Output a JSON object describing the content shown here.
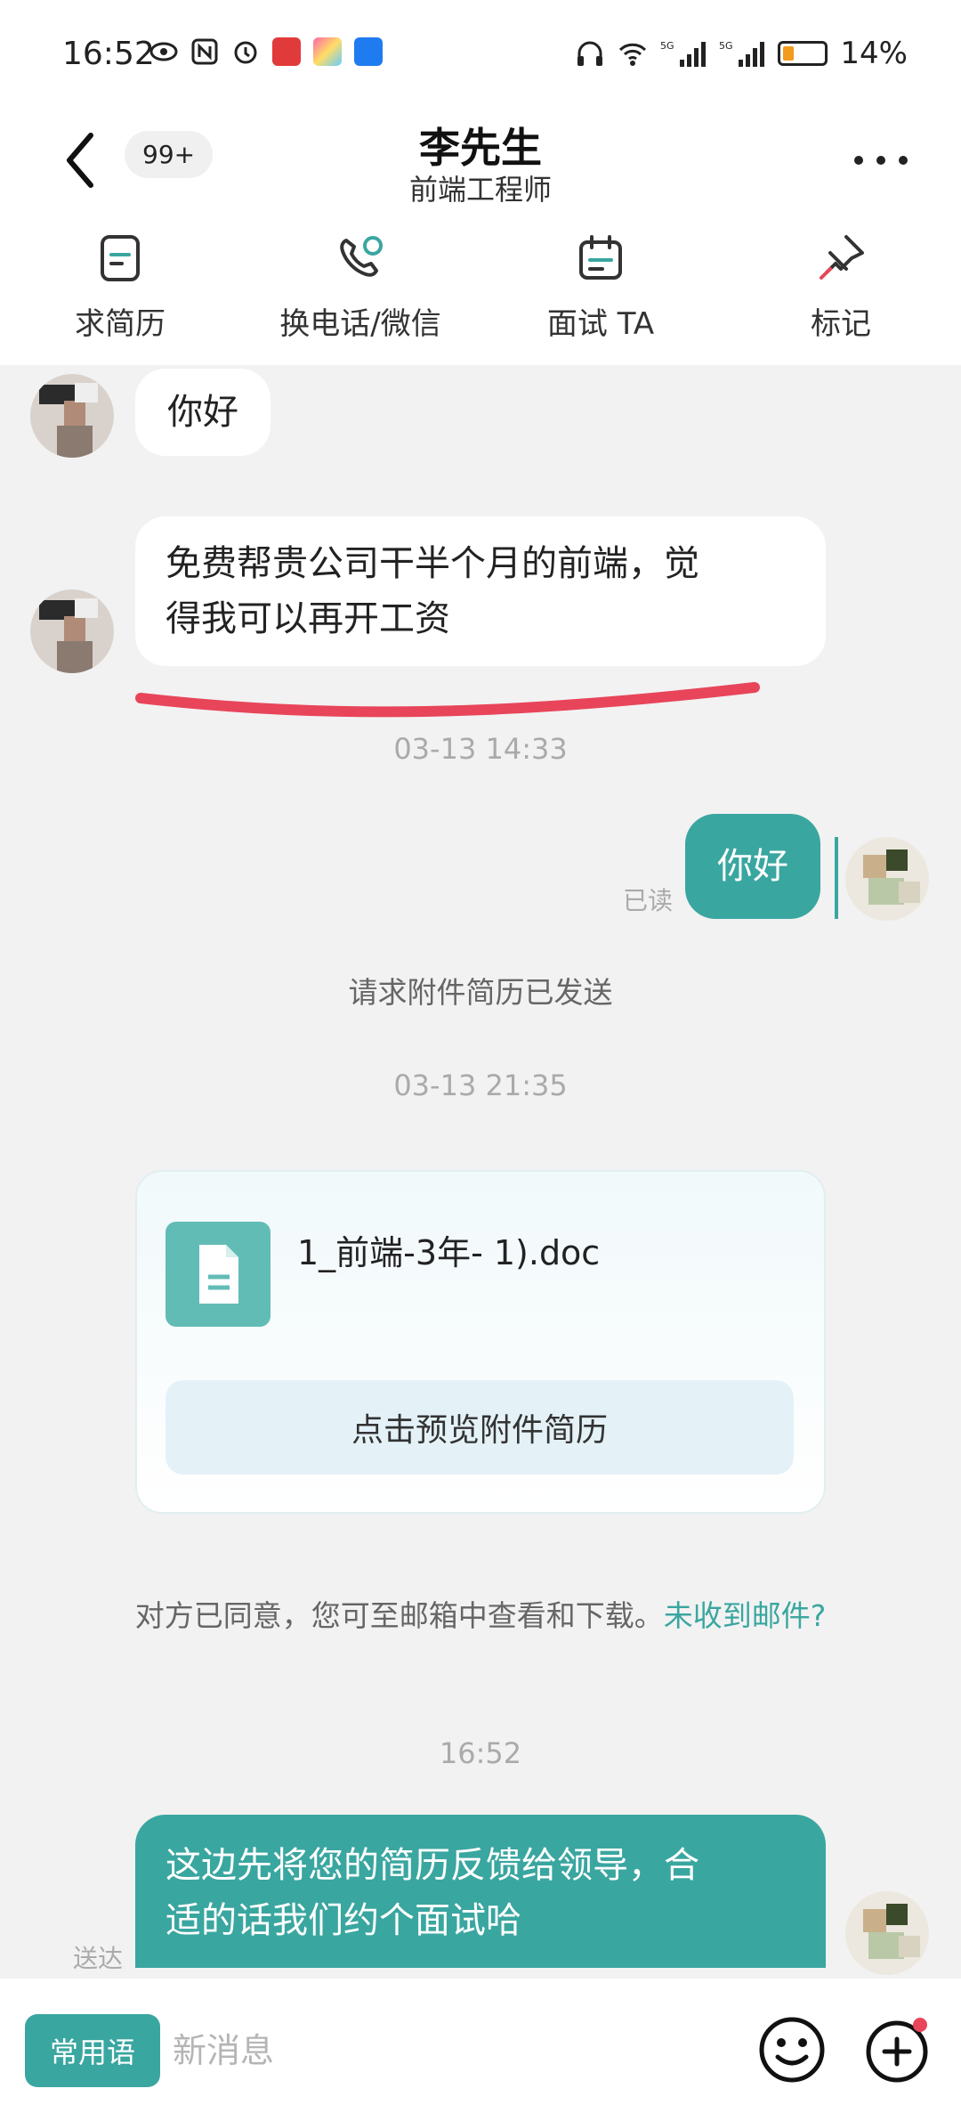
{
  "status_bar": {
    "time": "16:52",
    "battery_percent": "14%",
    "battery_level": 0.14,
    "network": "5G"
  },
  "header": {
    "badge": "99+",
    "name": "李先生",
    "position": "前端工程师"
  },
  "actions": [
    {
      "label": "求简历",
      "icon": "resume-icon"
    },
    {
      "label": "换电话/微信",
      "icon": "phone-wechat-icon"
    },
    {
      "label": "面试 TA",
      "icon": "calendar-icon"
    },
    {
      "label": "标记",
      "icon": "pin-icon"
    }
  ],
  "chat": {
    "msg1": "你好",
    "msg2_line1": "免费帮贵公司干半个月的前端，觉",
    "msg2_line2": "得我可以再开工资",
    "time1": "03-13 14:33",
    "msg3": "你好",
    "read_label": "已读",
    "system1": "请求附件简历已发送",
    "time2": "03-13 21:35",
    "file_name": "1_前端-3年-        1).doc",
    "preview_label": "点击预览附件简历",
    "system2_text": "对方已同意，您可至邮箱中查看和下载。",
    "system2_link": "未收到邮件?",
    "time3": "16:52",
    "msg4_line1": "这边先将您的简历反馈给领导，合",
    "msg4_line2": "适的话我们约个面试哈",
    "delivered_label": "送达"
  },
  "input_bar": {
    "phrases_label": "常用语",
    "placeholder": "新消息"
  },
  "colors": {
    "accent": "#3aa6a0",
    "underline": "#e8455a",
    "link": "#3aa6a0"
  }
}
